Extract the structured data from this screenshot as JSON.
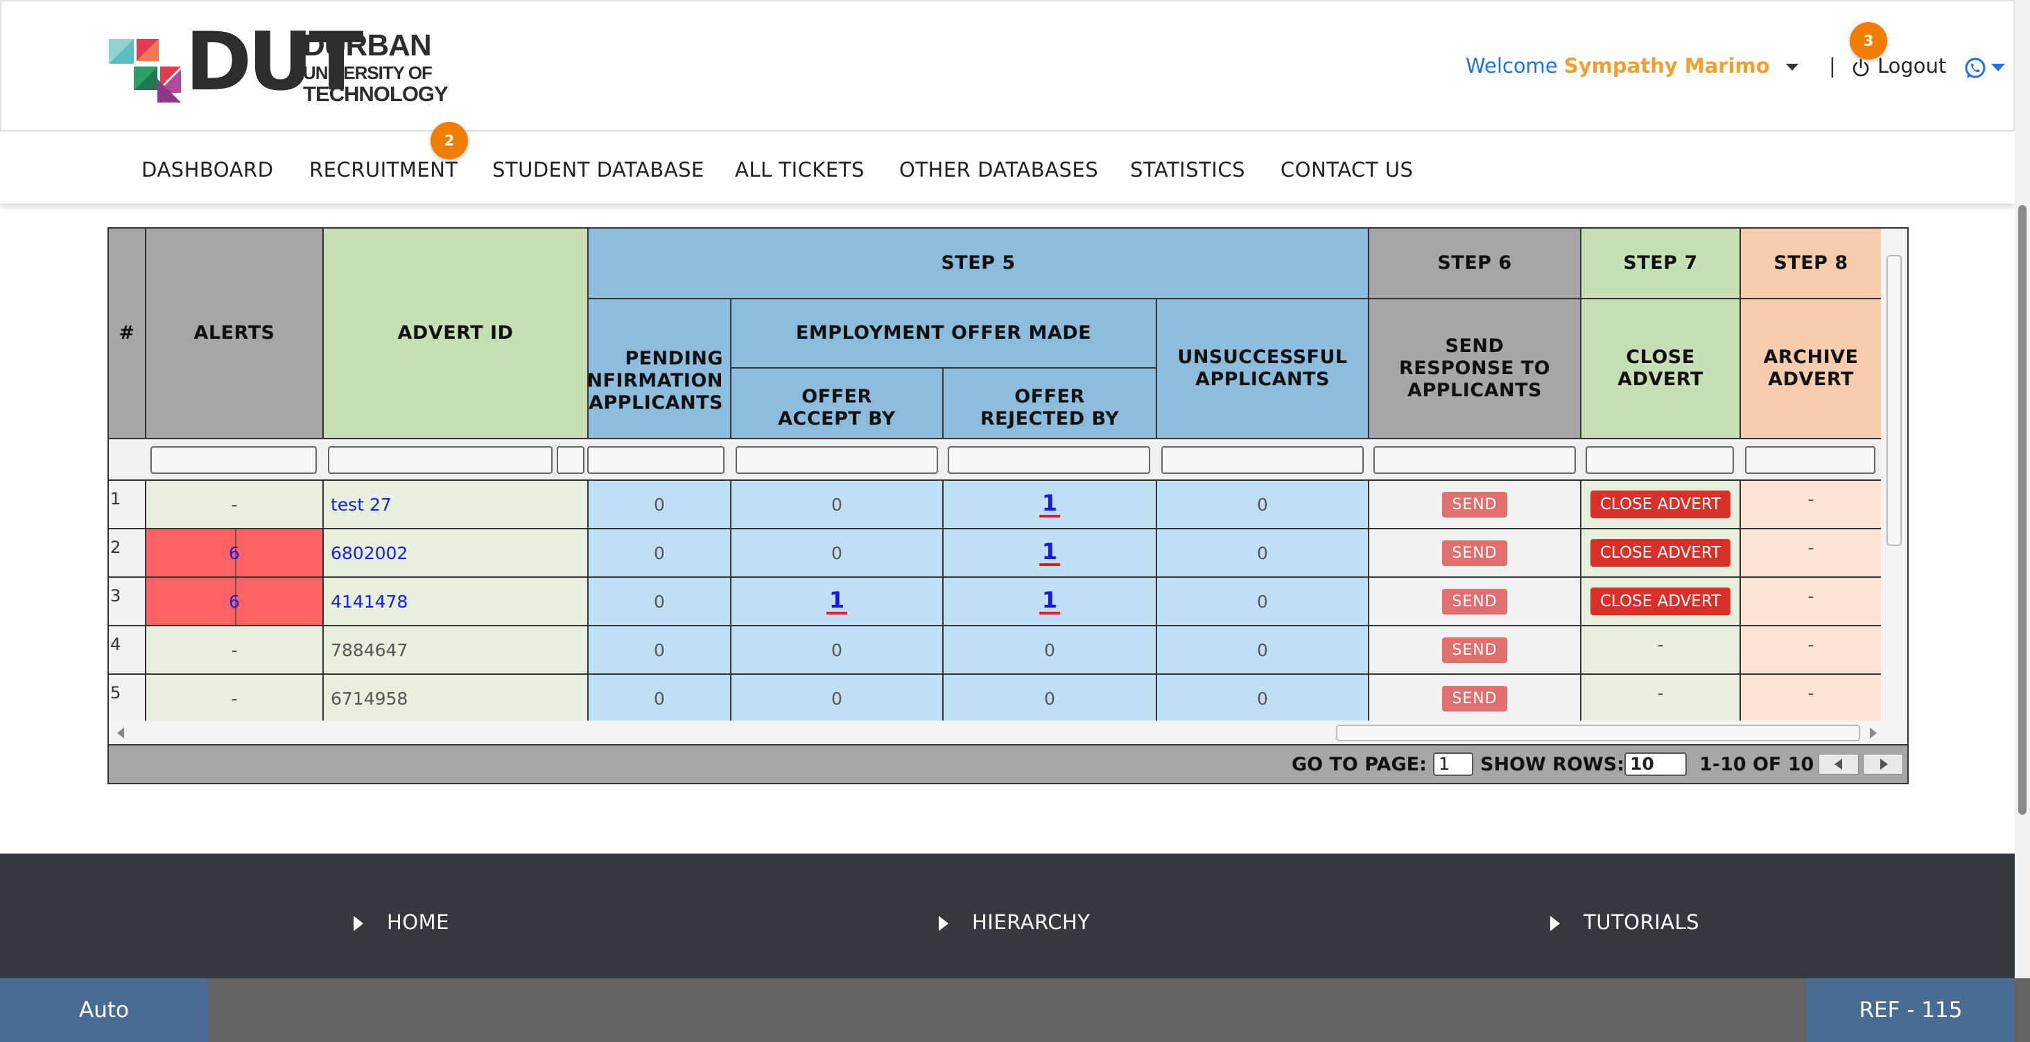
{
  "brand": {
    "logo_main": "DUT",
    "logo_line1": "DURBAN",
    "logo_line2": "UNIVERSITY OF",
    "logo_line3": "TECHNOLOGY"
  },
  "user": {
    "welcome_label": "Welcome",
    "name": "Sympathy Marimo",
    "separator": "|",
    "logout_label": "Logout",
    "notification_count": "3"
  },
  "nav": {
    "items": [
      {
        "label": "DASHBOARD"
      },
      {
        "label": "RECRUITMENT",
        "badge": "2"
      },
      {
        "label": "STUDENT DATABASE"
      },
      {
        "label": "ALL TICKETS"
      },
      {
        "label": "OTHER DATABASES"
      },
      {
        "label": "STATISTICS"
      },
      {
        "label": "CONTACT US"
      }
    ]
  },
  "table": {
    "headers": {
      "num": "#",
      "alerts": "ALERTS",
      "advert_id": "ADVERT ID",
      "step5": "STEP 5",
      "step6": "STEP 6",
      "step7": "STEP 7",
      "step8": "STEP 8",
      "pending": "PENDING CONFIRMATION APPLICANTS",
      "employment_offer": "EMPLOYMENT OFFER MADE",
      "offer_accept": "OFFER ACCEPT BY",
      "offer_rejected": "OFFER REJECTED BY",
      "unsuccessful": "UNSUCCESSFUL APPLICANTS",
      "send_response": "SEND RESPONSE TO APPLICANTS",
      "close_advert": "CLOSE ADVERT",
      "archive_advert": "ARCHIVE ADVERT"
    },
    "rows": [
      {
        "num": "1",
        "alert": "-",
        "advert_id": "test 27",
        "pending": "0",
        "accept": "0",
        "rejected": "1",
        "unsuccessful": "0",
        "send": "SEND",
        "close": "CLOSE ADVERT",
        "archive": "-"
      },
      {
        "num": "2",
        "alert": "6",
        "advert_id": "6802002",
        "pending": "0",
        "accept": "0",
        "rejected": "1",
        "unsuccessful": "0",
        "send": "SEND",
        "close": "CLOSE ADVERT",
        "archive": "-"
      },
      {
        "num": "3",
        "alert": "6",
        "advert_id": "4141478",
        "pending": "0",
        "accept": "1",
        "rejected": "1",
        "unsuccessful": "0",
        "send": "SEND",
        "close": "CLOSE ADVERT",
        "archive": "-"
      },
      {
        "num": "4",
        "alert": "-",
        "advert_id": "7884647",
        "pending": "0",
        "accept": "0",
        "rejected": "0",
        "unsuccessful": "0",
        "send": "SEND",
        "close": "-",
        "archive": "-"
      },
      {
        "num": "5",
        "alert": "-",
        "advert_id": "6714958",
        "pending": "0",
        "accept": "0",
        "rejected": "0",
        "unsuccessful": "0",
        "send": "SEND",
        "close": "-",
        "archive": "-"
      }
    ]
  },
  "pager": {
    "goto_label": "GO TO PAGE:",
    "page_value": "1",
    "rows_label": "SHOW ROWS:",
    "rows_value": "10",
    "range_label": "1-10 OF 10"
  },
  "footer": {
    "links": [
      {
        "label": "HOME"
      },
      {
        "label": "HIERARCHY"
      },
      {
        "label": "TUTORIALS"
      }
    ]
  },
  "bottom_bar": {
    "left_label": "Auto",
    "right_label": "REF - 115"
  },
  "colors": {
    "brand_blue": "#1a73e8",
    "name_orange": "#f0a030",
    "badge_orange": "#f07c00",
    "danger": "#d9302a",
    "footer": "#343a40"
  }
}
